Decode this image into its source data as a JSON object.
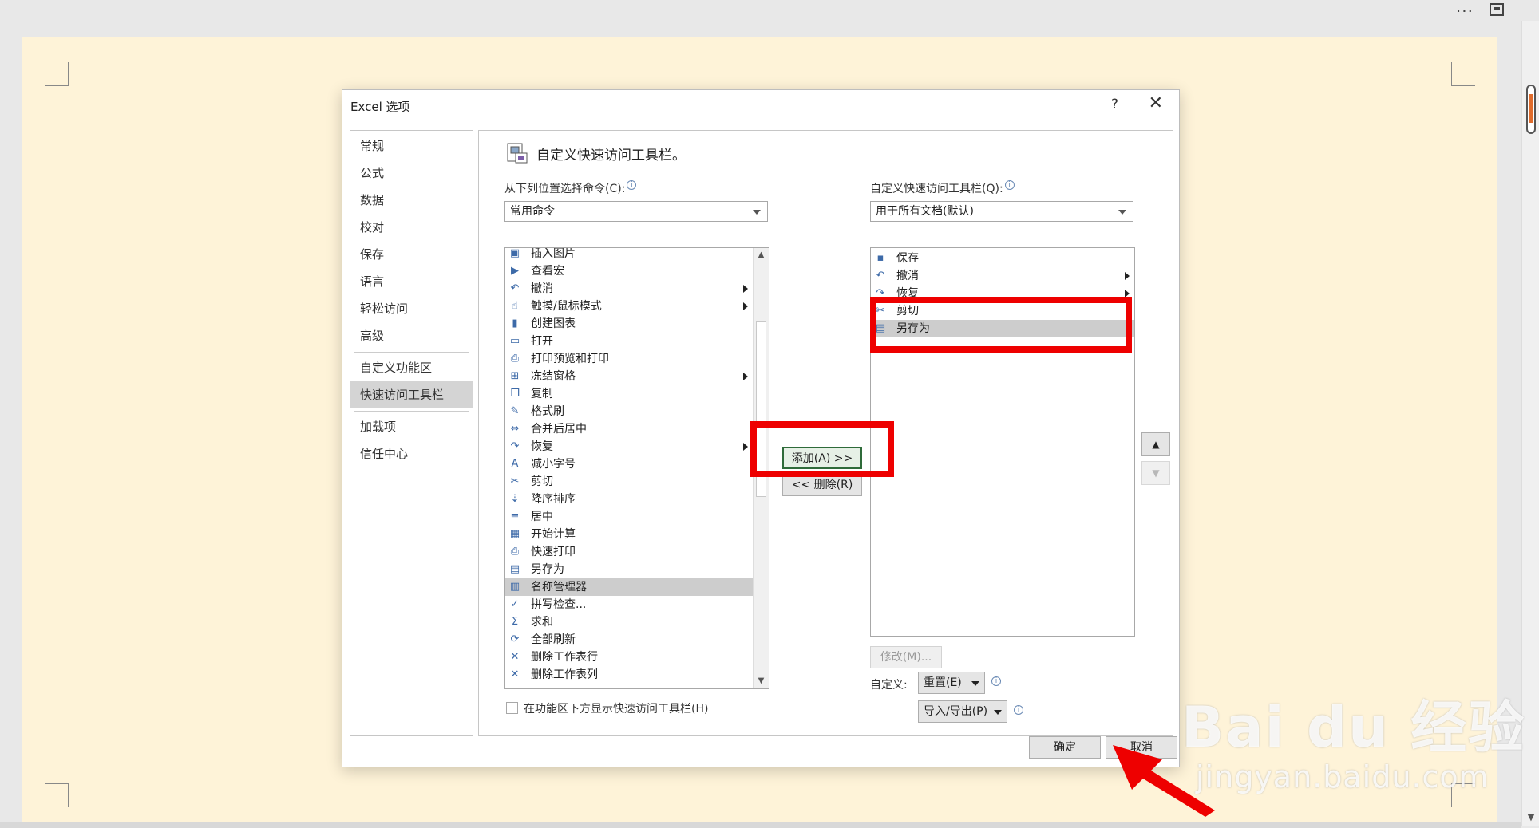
{
  "window": {
    "more_glyph": "···",
    "close_glyph": "✕"
  },
  "dialog": {
    "title": "Excel 选项",
    "help": "?",
    "close": "✕",
    "nav": [
      {
        "label": "常规",
        "active": false
      },
      {
        "label": "公式",
        "active": false
      },
      {
        "label": "数据",
        "active": false
      },
      {
        "label": "校对",
        "active": false
      },
      {
        "label": "保存",
        "active": false
      },
      {
        "label": "语言",
        "active": false
      },
      {
        "label": "轻松访问",
        "active": false
      },
      {
        "label": "高级",
        "active": false
      },
      {
        "label": "自定义功能区",
        "active": false
      },
      {
        "label": "快速访问工具栏",
        "active": true
      },
      {
        "label": "加载项",
        "active": false
      },
      {
        "label": "信任中心",
        "active": false
      }
    ],
    "section_title": "自定义快速访问工具栏。",
    "choose_from": {
      "label": "从下列位置选择命令(C):",
      "value": "常用命令"
    },
    "customize_for": {
      "label": "自定义快速访问工具栏(Q):",
      "value": "用于所有文档(默认)"
    },
    "commands": [
      {
        "label": "插入图片",
        "icon": "picture-icon",
        "sub": false
      },
      {
        "label": "查看宏",
        "icon": "play-icon",
        "sub": false
      },
      {
        "label": "撤消",
        "icon": "undo-icon",
        "sub": true
      },
      {
        "label": "触摸/鼠标模式",
        "icon": "touch-icon",
        "sub": true
      },
      {
        "label": "创建图表",
        "icon": "chart-icon",
        "sub": false
      },
      {
        "label": "打开",
        "icon": "folder-icon",
        "sub": false
      },
      {
        "label": "打印预览和打印",
        "icon": "print-preview-icon",
        "sub": false
      },
      {
        "label": "冻结窗格",
        "icon": "freeze-icon",
        "sub": true
      },
      {
        "label": "复制",
        "icon": "copy-icon",
        "sub": false
      },
      {
        "label": "格式刷",
        "icon": "format-painter-icon",
        "sub": false
      },
      {
        "label": "合并后居中",
        "icon": "merge-icon",
        "sub": false
      },
      {
        "label": "恢复",
        "icon": "redo-icon",
        "sub": true
      },
      {
        "label": "减小字号",
        "icon": "font-smaller-icon",
        "sub": false
      },
      {
        "label": "剪切",
        "icon": "scissors-icon",
        "sub": false
      },
      {
        "label": "降序排序",
        "icon": "sort-desc-icon",
        "sub": false
      },
      {
        "label": "居中",
        "icon": "align-center-icon",
        "sub": false
      },
      {
        "label": "开始计算",
        "icon": "calculator-icon",
        "sub": false
      },
      {
        "label": "快速打印",
        "icon": "quick-print-icon",
        "sub": false
      },
      {
        "label": "另存为",
        "icon": "save-as-icon",
        "sub": false
      },
      {
        "label": "名称管理器",
        "icon": "name-manager-icon",
        "sub": false,
        "selected": true
      },
      {
        "label": "拼写检查...",
        "icon": "spell-check-icon",
        "sub": false
      },
      {
        "label": "求和",
        "icon": "sum-icon",
        "sub": false
      },
      {
        "label": "全部刷新",
        "icon": "refresh-icon",
        "sub": false
      },
      {
        "label": "删除工作表行",
        "icon": "delete-row-icon",
        "sub": false
      },
      {
        "label": "删除工作表列",
        "icon": "delete-col-icon",
        "sub": false
      }
    ],
    "toolbar_items": [
      {
        "label": "保存",
        "icon": "save-icon",
        "sub": false
      },
      {
        "label": "撤消",
        "icon": "undo-icon",
        "sub": true
      },
      {
        "label": "恢复",
        "icon": "redo-icon",
        "sub": true
      },
      {
        "label": "剪切",
        "icon": "scissors-icon",
        "sub": false
      },
      {
        "label": "另存为",
        "icon": "save-as-icon",
        "sub": false,
        "selected": true
      }
    ],
    "add_button": "添加(A) >>",
    "remove_button": "<< 删除(R)",
    "modify_button": "修改(M)...",
    "customize_label": "自定义:",
    "reset_button": "重置(E)",
    "import_export_button": "导入/导出(P)",
    "show_below_ribbon": "在功能区下方显示快速访问工具栏(H)",
    "ok_button": "确定",
    "cancel_button": "取消"
  },
  "watermark": {
    "brand": "Bai du 经验",
    "url": "jingyan.baidu.com"
  },
  "colors": {
    "highlight_red": "#ee0000",
    "page_bg": "#fef3d8",
    "selected_row": "#cdcdcd"
  }
}
